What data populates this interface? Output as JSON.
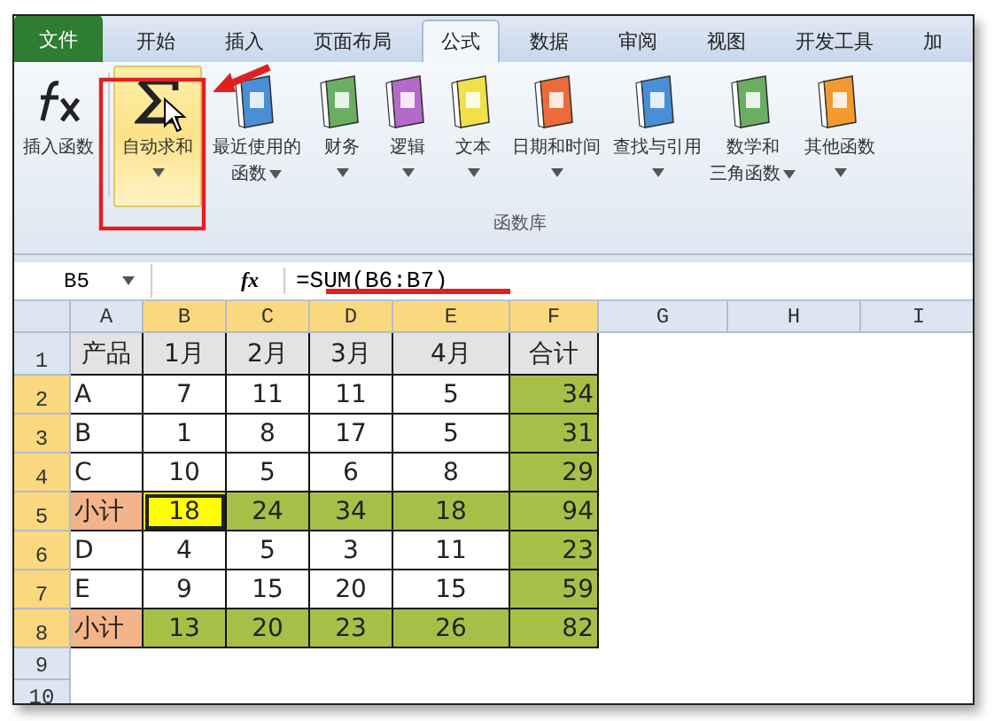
{
  "tabs": [
    {
      "label": "文件",
      "kind": "file",
      "selected": false
    },
    {
      "label": "开始",
      "kind": "tab",
      "selected": false
    },
    {
      "label": "插入",
      "kind": "tab",
      "selected": false
    },
    {
      "label": "页面布局",
      "kind": "tab",
      "selected": false
    },
    {
      "label": "公式",
      "kind": "tab",
      "selected": true
    },
    {
      "label": "数据",
      "kind": "tab",
      "selected": false
    },
    {
      "label": "审阅",
      "kind": "tab",
      "selected": false
    },
    {
      "label": "视图",
      "kind": "tab",
      "selected": false
    },
    {
      "label": "开发工具",
      "kind": "tab",
      "selected": false
    },
    {
      "label": "加",
      "kind": "tab",
      "selected": false
    }
  ],
  "ribbon": {
    "buttons": [
      {
        "kind": "fx",
        "lines": [
          "插入函数"
        ],
        "dropdown": false,
        "highlighted": false
      },
      {
        "kind": "sigma",
        "lines": [
          "自动求和"
        ],
        "dropdown": true,
        "highlighted": true
      },
      {
        "kind": "book",
        "lines": [
          "最近使用的",
          "函数"
        ],
        "dropdown": true,
        "highlighted": false
      },
      {
        "kind": "book",
        "lines": [
          "财务"
        ],
        "dropdown": true,
        "highlighted": false
      },
      {
        "kind": "book",
        "lines": [
          "逻辑"
        ],
        "dropdown": true,
        "highlighted": false
      },
      {
        "kind": "book",
        "lines": [
          "文本"
        ],
        "dropdown": true,
        "highlighted": false
      },
      {
        "kind": "book",
        "lines": [
          "日期和时间"
        ],
        "dropdown": true,
        "highlighted": false
      },
      {
        "kind": "book",
        "lines": [
          "查找与引用"
        ],
        "dropdown": true,
        "highlighted": false
      },
      {
        "kind": "book",
        "lines": [
          "数学和",
          "三角函数"
        ],
        "dropdown": true,
        "highlighted": false
      },
      {
        "kind": "book",
        "lines": [
          "其他函数"
        ],
        "dropdown": true,
        "highlighted": false
      }
    ],
    "group_label": "函数库"
  },
  "formula_bar": {
    "name_box": "B5",
    "fx": "fx",
    "formula": "=SUM(B6:B7)"
  },
  "columns": [
    {
      "label": "A",
      "highlighted": false
    },
    {
      "label": "B",
      "highlighted": true
    },
    {
      "label": "C",
      "highlighted": true
    },
    {
      "label": "D",
      "highlighted": true
    },
    {
      "label": "E",
      "highlighted": true
    },
    {
      "label": "F",
      "highlighted": true
    },
    {
      "label": "G",
      "highlighted": false
    },
    {
      "label": "H",
      "highlighted": false
    },
    {
      "label": "I",
      "highlighted": false
    }
  ],
  "rows": [
    {
      "header": "1",
      "highlighted": false,
      "cells": [
        {
          "text": "产品",
          "color": "#e3e3e3",
          "selected": false
        },
        {
          "text": "1月",
          "color": "#e3e3e3",
          "selected": false
        },
        {
          "text": "2月",
          "color": "#e3e3e3",
          "selected": false
        },
        {
          "text": "3月",
          "color": "#e3e3e3",
          "selected": false
        },
        {
          "text": "4月",
          "color": "#e3e3e3",
          "selected": false
        },
        {
          "text": "合计",
          "color": "#e3e3e3",
          "selected": false
        }
      ]
    },
    {
      "header": "2",
      "highlighted": true,
      "cells": [
        {
          "text": "A",
          "color": "#ffffff",
          "selected": false
        },
        {
          "text": "7",
          "color": "#ffffff",
          "selected": false
        },
        {
          "text": "11",
          "color": "#ffffff",
          "selected": false
        },
        {
          "text": "11",
          "color": "#ffffff",
          "selected": false
        },
        {
          "text": "5",
          "color": "#ffffff",
          "selected": false
        },
        {
          "text": "34",
          "color": "#a8bf47",
          "selected": false
        }
      ]
    },
    {
      "header": "3",
      "highlighted": true,
      "cells": [
        {
          "text": "B",
          "color": "#ffffff",
          "selected": false
        },
        {
          "text": "1",
          "color": "#ffffff",
          "selected": false
        },
        {
          "text": "8",
          "color": "#ffffff",
          "selected": false
        },
        {
          "text": "17",
          "color": "#ffffff",
          "selected": false
        },
        {
          "text": "5",
          "color": "#ffffff",
          "selected": false
        },
        {
          "text": "31",
          "color": "#a8bf47",
          "selected": false
        }
      ]
    },
    {
      "header": "4",
      "highlighted": true,
      "cells": [
        {
          "text": "C",
          "color": "#ffffff",
          "selected": false
        },
        {
          "text": "10",
          "color": "#ffffff",
          "selected": false
        },
        {
          "text": "5",
          "color": "#ffffff",
          "selected": false
        },
        {
          "text": "6",
          "color": "#ffffff",
          "selected": false
        },
        {
          "text": "8",
          "color": "#ffffff",
          "selected": false
        },
        {
          "text": "29",
          "color": "#a8bf47",
          "selected": false
        }
      ]
    },
    {
      "header": "5",
      "highlighted": true,
      "cells": [
        {
          "text": "小计",
          "color": "#f4b48a",
          "selected": false
        },
        {
          "text": "18",
          "color": "#ffff00",
          "selected": true
        },
        {
          "text": "24",
          "color": "#a8bf47",
          "selected": false
        },
        {
          "text": "34",
          "color": "#a8bf47",
          "selected": false
        },
        {
          "text": "18",
          "color": "#a8bf47",
          "selected": false
        },
        {
          "text": "94",
          "color": "#a8bf47",
          "selected": false
        }
      ]
    },
    {
      "header": "6",
      "highlighted": true,
      "cells": [
        {
          "text": "D",
          "color": "#ffffff",
          "selected": false
        },
        {
          "text": "4",
          "color": "#ffffff",
          "selected": false
        },
        {
          "text": "5",
          "color": "#ffffff",
          "selected": false
        },
        {
          "text": "3",
          "color": "#ffffff",
          "selected": false
        },
        {
          "text": "11",
          "color": "#ffffff",
          "selected": false
        },
        {
          "text": "23",
          "color": "#a8bf47",
          "selected": false
        }
      ]
    },
    {
      "header": "7",
      "highlighted": true,
      "cells": [
        {
          "text": "E",
          "color": "#ffffff",
          "selected": false
        },
        {
          "text": "9",
          "color": "#ffffff",
          "selected": false
        },
        {
          "text": "15",
          "color": "#ffffff",
          "selected": false
        },
        {
          "text": "20",
          "color": "#ffffff",
          "selected": false
        },
        {
          "text": "15",
          "color": "#ffffff",
          "selected": false
        },
        {
          "text": "59",
          "color": "#a8bf47",
          "selected": false
        }
      ]
    },
    {
      "header": "8",
      "highlighted": true,
      "cells": [
        {
          "text": "小计",
          "color": "#f4b48a",
          "selected": false
        },
        {
          "text": "13",
          "color": "#a8bf47",
          "selected": false
        },
        {
          "text": "20",
          "color": "#a8bf47",
          "selected": false
        },
        {
          "text": "23",
          "color": "#a8bf47",
          "selected": false
        },
        {
          "text": "26",
          "color": "#a8bf47",
          "selected": false
        },
        {
          "text": "82",
          "color": "#a8bf47",
          "selected": false
        }
      ]
    },
    {
      "header": "9",
      "highlighted": false
    },
    {
      "header": "10",
      "highlighted": false
    }
  ]
}
